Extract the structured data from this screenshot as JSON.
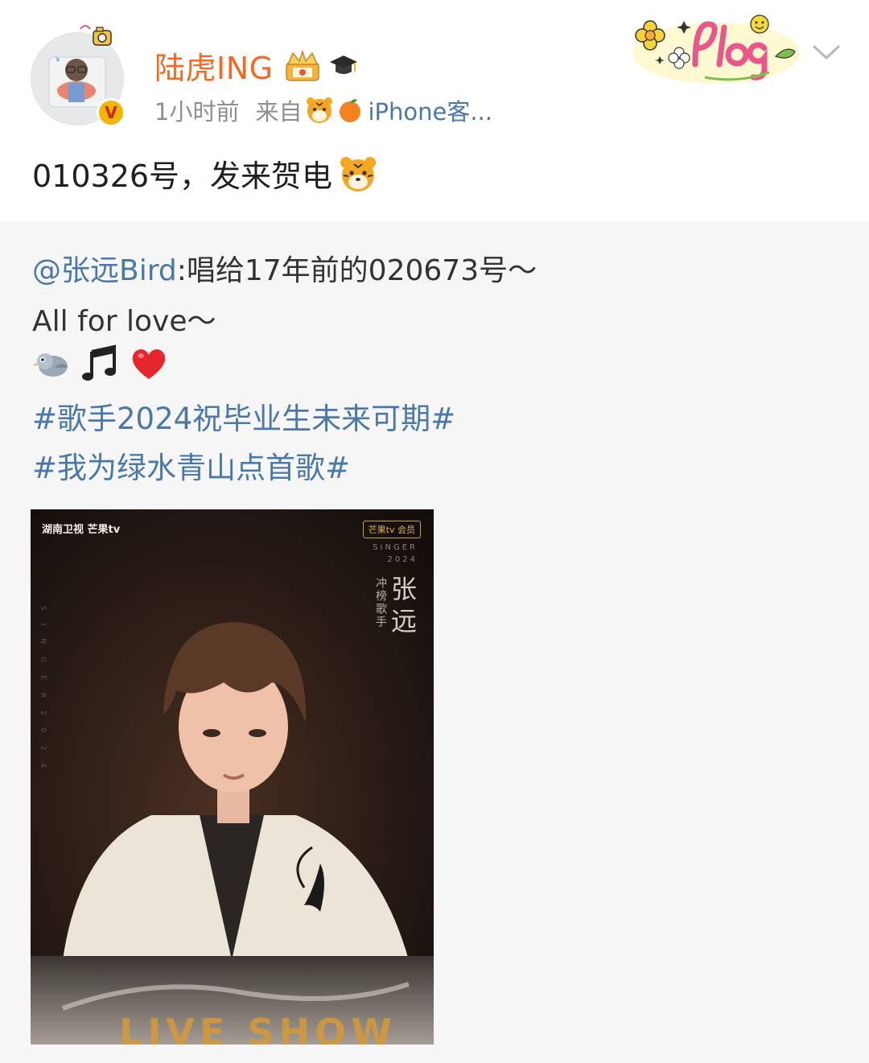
{
  "header": {
    "username": "陆虎ING",
    "verified_mark": "V",
    "time": "1小时前",
    "source_prefix": "来自",
    "source_name": "iPhone客...",
    "icons": [
      "crown-badge-icon",
      "graduation-cap-icon",
      "tiger-icon",
      "orange-icon",
      "plog-sticker-icon",
      "chevron-down-icon"
    ]
  },
  "post": {
    "text": "010326号，发来贺电"
  },
  "repost": {
    "mention": "@张远Bird",
    "line1_rest": ":唱给17年前的020673号～",
    "line2": "All for love～",
    "emojis": [
      "bird-icon",
      "music-note-icon",
      "heart-icon"
    ],
    "hashtag1": "#歌手2024祝毕业生未来可期#",
    "hashtag2": "#我为绿水青山点首歌#",
    "poster": {
      "logo_left": "湖南卫视 芒果tv",
      "logo_right": "芒果tv 会员",
      "singer_label": "SINGER",
      "year": "2024",
      "role": "冲榜歌手",
      "name": "张远",
      "vertical_text": "SINGER2024",
      "bottom_text": "LIVE SHOW"
    }
  },
  "colors": {
    "username": "#f06a24",
    "link": "#4a78a8",
    "meta": "#8f8f8f",
    "repost_bg": "#f6f6f6"
  }
}
